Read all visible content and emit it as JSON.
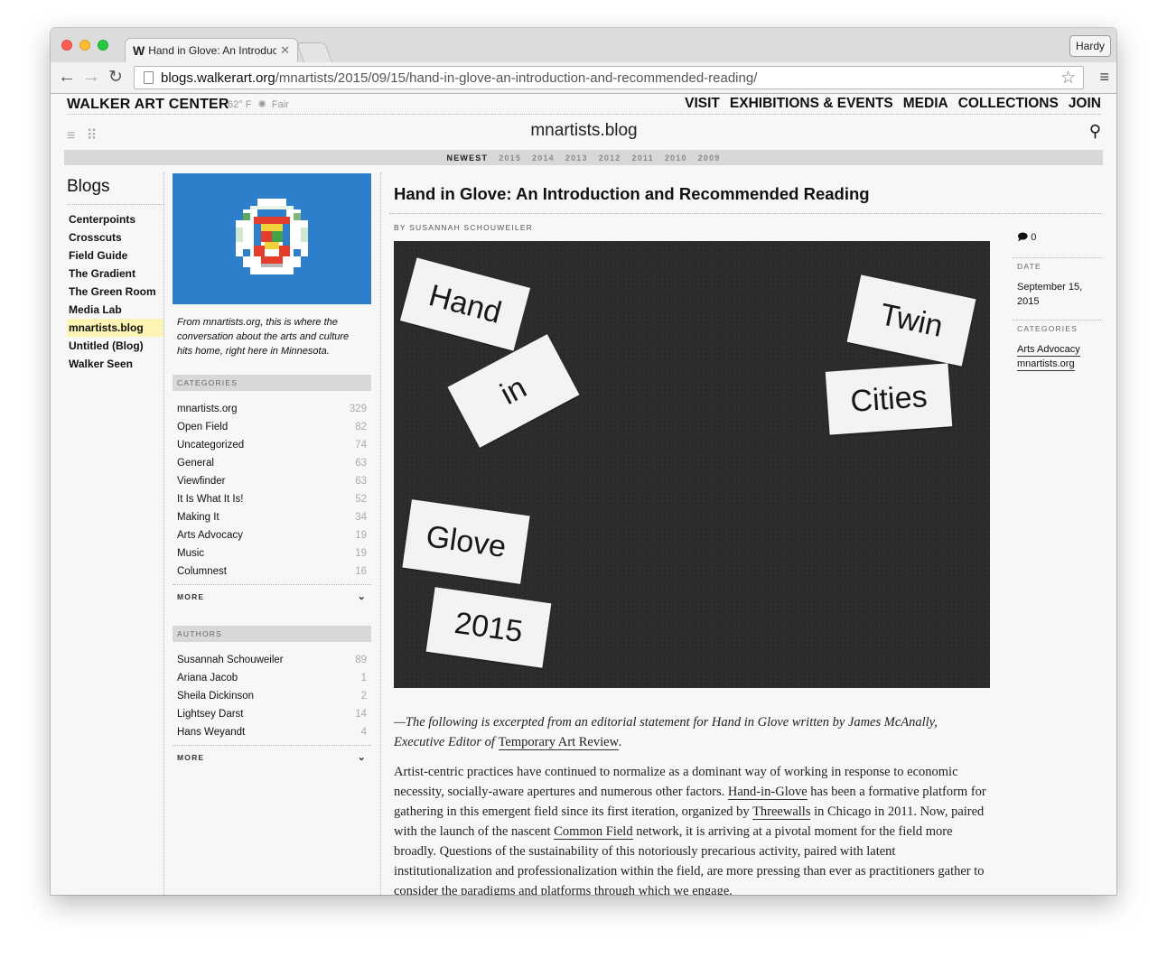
{
  "browser": {
    "tab_title": "Hand in Glove: An Introduc",
    "tab_favicon": "W",
    "profile_name": "Hardy",
    "url_host": "blogs.walkerart.org",
    "url_path": "/mnartists/2015/09/15/hand-in-glove-an-introduction-and-recommended-reading/"
  },
  "site": {
    "brand": "WALKER ART CENTER",
    "weather_temp": "62° F",
    "weather_desc": "Fair",
    "nav": [
      "VISIT",
      "EXHIBITIONS & EVENTS",
      "MEDIA",
      "COLLECTIONS",
      "JOIN"
    ],
    "blog_title": "mnartists.blog",
    "years": [
      "NEWEST",
      "2015",
      "2014",
      "2013",
      "2012",
      "2011",
      "2010",
      "2009"
    ]
  },
  "blogs": {
    "heading": "Blogs",
    "items": [
      "Centerpoints",
      "Crosscuts",
      "Field Guide",
      "The Gradient",
      "The Green Room",
      "Media Lab",
      "mnartists.blog",
      "Untitled (Blog)",
      "Walker Seen"
    ],
    "active": "mnartists.blog"
  },
  "sidebar": {
    "description": "From mnartists.org, this is where the conversation about the arts and culture hits home, right here in Minnesota.",
    "categories_label": "CATEGORIES",
    "categories": [
      {
        "name": "mnartists.org",
        "count": "329"
      },
      {
        "name": "Open Field",
        "count": "82"
      },
      {
        "name": "Uncategorized",
        "count": "74"
      },
      {
        "name": "General",
        "count": "63"
      },
      {
        "name": "Viewfinder",
        "count": "63"
      },
      {
        "name": "It Is What It Is!",
        "count": "52"
      },
      {
        "name": "Making It",
        "count": "34"
      },
      {
        "name": "Arts Advocacy",
        "count": "19"
      },
      {
        "name": "Music",
        "count": "19"
      },
      {
        "name": "Columnest",
        "count": "16"
      }
    ],
    "more_label": "MORE",
    "authors_label": "AUTHORS",
    "authors": [
      {
        "name": "Susannah Schouweiler",
        "count": "89"
      },
      {
        "name": "Ariana Jacob",
        "count": "1"
      },
      {
        "name": "Sheila Dickinson",
        "count": "2"
      },
      {
        "name": "Lightsey Darst",
        "count": "14"
      },
      {
        "name": "Hans Weyandt",
        "count": "4"
      }
    ]
  },
  "article": {
    "title": "Hand in Glove: An Introduction and Recommended Reading",
    "byline": "BY SUSANNAH SCHOUWEILER",
    "image_words": [
      "Hand",
      "in",
      "Twin",
      "Cities",
      "Glove",
      "2015"
    ],
    "intro_text": "—The following is excerpted from an editorial statement for Hand in Glove written by James McAnally, Executive Editor of",
    "intro_link": "Temporary Art Review",
    "p1_a": "Artist-centric practices have continued to normalize as a dominant way of working in response to economic necessity, socially-aware apertures and numerous other factors.",
    "p1_link1": "Hand-in-Glove",
    "p1_b": "has been a formative platform for gathering in this emergent field since its first iteration, organized by",
    "p1_link2": "Threewalls",
    "p1_c": "in Chicago in 2011. Now, paired with the launch of the nascent",
    "p1_link3": "Common Field",
    "p1_d": "network, it is arriving at a pivotal moment for the field more broadly. Questions of the sustainability of this notoriously precarious activity, paired with latent institutionalization and professionalization within the field, are more pressing than ever as practitioners gather to consider the paradigms and platforms through which we engage."
  },
  "meta": {
    "comment_count": "0",
    "date_label": "DATE",
    "date_value": "September 15, 2015",
    "categories_label": "CATEGORIES",
    "categories": [
      "Arts Advocacy",
      "mnartists.org"
    ]
  }
}
